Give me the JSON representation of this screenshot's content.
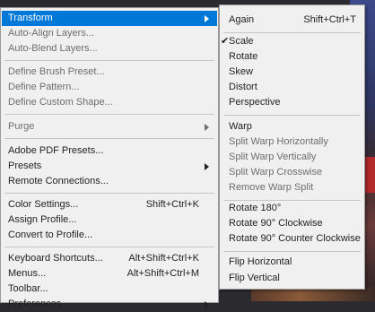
{
  "menu": {
    "items": [
      {
        "label": "Transform",
        "highlighted": true,
        "submenu": true
      },
      {
        "label": "Auto-Align Layers...",
        "disabled": true
      },
      {
        "label": "Auto-Blend Layers...",
        "disabled": true
      },
      {
        "label": "Define Brush Preset...",
        "disabled": true
      },
      {
        "label": "Define Pattern...",
        "disabled": true
      },
      {
        "label": "Define Custom Shape...",
        "disabled": true
      },
      {
        "label": "Purge",
        "disabled": true,
        "submenu": true
      },
      {
        "label": "Adobe PDF Presets..."
      },
      {
        "label": "Presets",
        "submenu": true
      },
      {
        "label": "Remote Connections..."
      },
      {
        "label": "Color Settings...",
        "shortcut": "Shift+Ctrl+K"
      },
      {
        "label": "Assign Profile..."
      },
      {
        "label": "Convert to Profile..."
      },
      {
        "label": "Keyboard Shortcuts...",
        "shortcut": "Alt+Shift+Ctrl+K"
      },
      {
        "label": "Menus...",
        "shortcut": "Alt+Shift+Ctrl+M"
      },
      {
        "label": "Toolbar..."
      },
      {
        "label": "Preferences",
        "submenu": true
      }
    ]
  },
  "submenu": {
    "items": [
      {
        "label": "Again",
        "shortcut": "Shift+Ctrl+T"
      },
      {
        "label": "Scale",
        "checked": true
      },
      {
        "label": "Rotate"
      },
      {
        "label": "Skew"
      },
      {
        "label": "Distort"
      },
      {
        "label": "Perspective"
      },
      {
        "label": "Warp"
      },
      {
        "label": "Split Warp Horizontally",
        "disabled": true
      },
      {
        "label": "Split Warp Vertically",
        "disabled": true
      },
      {
        "label": "Split Warp Crosswise",
        "disabled": true
      },
      {
        "label": "Remove Warp Split",
        "disabled": true
      },
      {
        "label": "Rotate 180°"
      },
      {
        "label": "Rotate 90° Clockwise"
      },
      {
        "label": "Rotate 90° Counter Clockwise"
      },
      {
        "label": "Flip Horizontal"
      },
      {
        "label": "Flip Vertical"
      }
    ],
    "check_glyph": "✔"
  }
}
